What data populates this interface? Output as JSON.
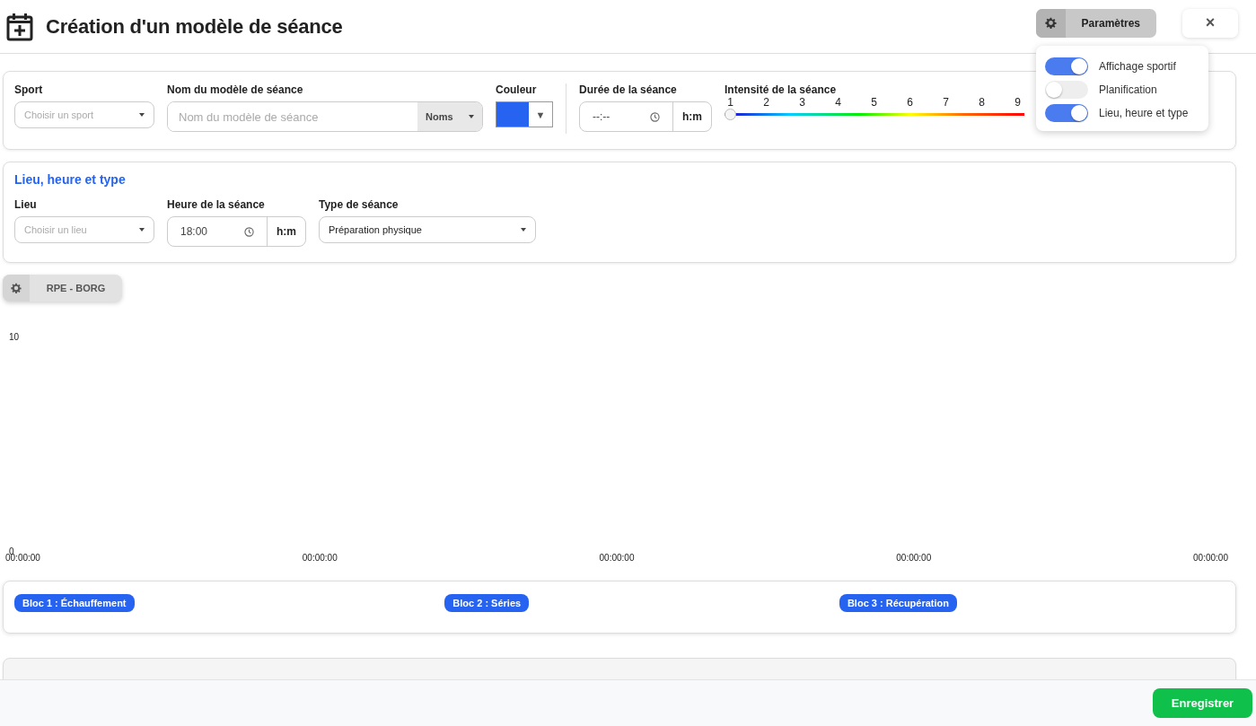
{
  "header": {
    "title": "Création d'un modèle de séance",
    "settings_button": "Paramètres",
    "close_button": "×"
  },
  "settings_menu": [
    {
      "label": "Affichage sportif",
      "on": true
    },
    {
      "label": "Planification",
      "on": false
    },
    {
      "label": "Lieu, heure et type",
      "on": true
    }
  ],
  "main_card": {
    "sport": {
      "label": "Sport",
      "placeholder": "Choisir un sport"
    },
    "name": {
      "label": "Nom du modèle de séance",
      "placeholder": "Nom du modèle de séance",
      "addon": "Noms"
    },
    "color": {
      "label": "Couleur",
      "color": "#2563f0",
      "caret": "▼"
    },
    "duration": {
      "label": "Durée de la séance",
      "value": "--:--",
      "unit": "h:m"
    },
    "intensity": {
      "label": "Intensité de la séance",
      "ticks": [
        "1",
        "2",
        "3",
        "4",
        "5",
        "6",
        "7",
        "8",
        "9"
      ],
      "level": 0
    }
  },
  "place_card": {
    "title": "Lieu, heure et type",
    "place": {
      "label": "Lieu",
      "placeholder": "Choisir un lieu"
    },
    "time": {
      "label": "Heure de la séance",
      "value": "18:00",
      "unit": "h:m"
    },
    "type": {
      "label": "Type de séance",
      "value": "Préparation physique"
    }
  },
  "rpe_button": "RPE - BORG",
  "chart": {
    "y_labels": [
      "10",
      "0"
    ],
    "x_labels": [
      "00:00:00",
      "00:00:00",
      "00:00:00",
      "00:00:00",
      "00:00:00"
    ]
  },
  "blocks": [
    {
      "label": "Bloc 1 : Échauffement"
    },
    {
      "label": "Bloc 2 : Séries"
    },
    {
      "label": "Bloc 3 : Récupération"
    }
  ],
  "save_button": "Enregistrer"
}
